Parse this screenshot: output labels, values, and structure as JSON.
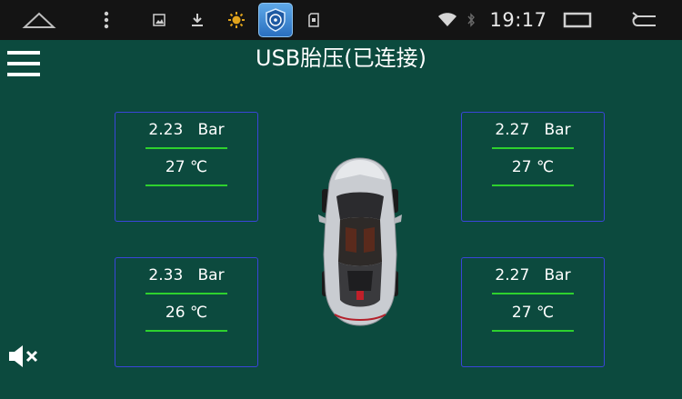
{
  "status_bar": {
    "time": "19:17",
    "icons": [
      "home-icon",
      "menu-dots-icon",
      "image-icon",
      "download-icon",
      "brightness-icon",
      "tpms-app-icon",
      "sd-card-icon",
      "wifi-icon",
      "bluetooth-icon",
      "recent-apps-icon",
      "back-icon"
    ]
  },
  "header": {
    "title": "USB胎压(已连接)"
  },
  "tires": {
    "front_left": {
      "pressure": "2.23   Bar",
      "temperature": "27 ℃"
    },
    "front_right": {
      "pressure": "2.27   Bar",
      "temperature": "27 ℃"
    },
    "rear_left": {
      "pressure": "2.33   Bar",
      "temperature": "26 ℃"
    },
    "rear_right": {
      "pressure": "2.27   Bar",
      "temperature": "27 ℃"
    }
  },
  "colors": {
    "background": "#0c4a3e",
    "panel_border": "#3a45d8",
    "divider": "#2ed12e",
    "status_bar": "#141414"
  }
}
